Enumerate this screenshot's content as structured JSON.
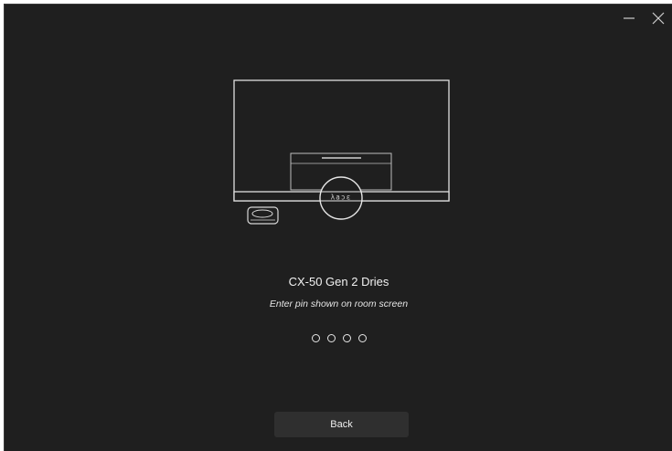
{
  "window": {
    "background": "#1f1f1f",
    "controls": {
      "minimize_icon": "minimize-icon",
      "close_icon": "close-icon"
    }
  },
  "illustration": {
    "room_screen_code": "λаɔε"
  },
  "pairing": {
    "device_name": "CX-50 Gen 2 Dries",
    "instruction": "Enter pin shown on room screen",
    "pin_length": 4,
    "pin_entered": 0
  },
  "actions": {
    "back_label": "Back"
  }
}
